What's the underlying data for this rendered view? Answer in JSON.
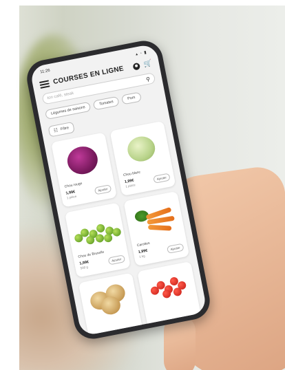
{
  "status": {
    "time": "11:26",
    "icons": "signal-wifi-battery"
  },
  "app": {
    "title": "COURSES EN LIGNE"
  },
  "search": {
    "placeholder": "ton café, steak"
  },
  "chips": [
    {
      "label": "Légumes de saisons"
    },
    {
      "label": "Tomates"
    },
    {
      "label": "Pom"
    }
  ],
  "filter": {
    "label": "Filtre"
  },
  "products": [
    {
      "name": "Chou rouge",
      "price": "1,99€",
      "unit": "1 pièce",
      "add": "Ajouter"
    },
    {
      "name": "Chou blanc",
      "price": "1,99€",
      "unit": "1 pièce",
      "add": "Ajouter"
    },
    {
      "name": "Chou de Bruxelle",
      "price": "1,99€",
      "unit": "500 g",
      "add": "Ajouter"
    },
    {
      "name": "Carottes",
      "price": "1,99€",
      "unit": "1 kg",
      "add": "Ajouter"
    },
    {
      "name": "",
      "price": "",
      "unit": "",
      "add": ""
    },
    {
      "name": "",
      "price": "",
      "unit": "",
      "add": ""
    }
  ],
  "colors": {
    "accent": "#222222",
    "background": "#f2f2f2",
    "card": "#ffffff"
  },
  "icons": [
    "menu-icon",
    "account-icon",
    "cart-icon",
    "search-icon",
    "filter-icon"
  ]
}
